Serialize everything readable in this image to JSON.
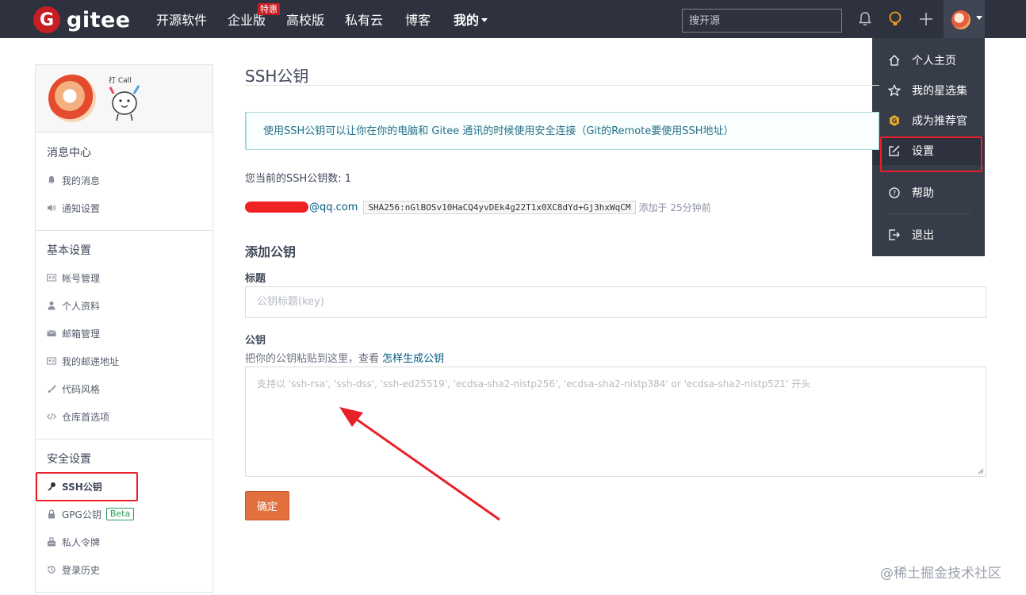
{
  "brand": {
    "logo_letter": "G",
    "name": "gitee"
  },
  "nav": {
    "items": [
      "开源软件",
      "企业版",
      "高校版",
      "私有云",
      "博客"
    ],
    "mine": "我的",
    "special_badge": "特惠",
    "search_placeholder": "搜开源"
  },
  "dropdown": {
    "items": [
      {
        "label": "个人主页",
        "icon": "home-icon"
      },
      {
        "label": "我的星选集",
        "icon": "star-icon"
      },
      {
        "label": "成为推荐官",
        "icon": "gitee-badge-icon"
      },
      {
        "label": "设置",
        "icon": "edit-icon"
      },
      {
        "label": "帮助",
        "icon": "help-icon"
      },
      {
        "label": "退出",
        "icon": "logout-icon"
      }
    ],
    "active": "设置"
  },
  "sidebar": {
    "mascot_text": "打 Call",
    "sections": [
      {
        "title": "消息中心",
        "items": [
          {
            "label": "我的消息",
            "icon": "bell-icon"
          },
          {
            "label": "通知设置",
            "icon": "volume-icon"
          }
        ]
      },
      {
        "title": "基本设置",
        "items": [
          {
            "label": "帐号管理",
            "icon": "id-card-icon"
          },
          {
            "label": "个人资料",
            "icon": "user-icon"
          },
          {
            "label": "邮箱管理",
            "icon": "mail-icon"
          },
          {
            "label": "我的邮递地址",
            "icon": "address-card-icon"
          },
          {
            "label": "代码风格",
            "icon": "brush-icon"
          },
          {
            "label": "仓库首选项",
            "icon": "code-icon"
          }
        ]
      },
      {
        "title": "安全设置",
        "items": [
          {
            "label": "SSH公钥",
            "icon": "key-icon"
          },
          {
            "label": "GPG公钥",
            "icon": "lock-icon",
            "badge": "Beta"
          },
          {
            "label": "私人令牌",
            "icon": "token-icon"
          },
          {
            "label": "登录历史",
            "icon": "history-icon"
          }
        ]
      }
    ],
    "active": "SSH公钥"
  },
  "main": {
    "title": "SSH公钥",
    "info": "使用SSH公钥可以让你在你的电脑和 Gitee 通讯的时候使用安全连接（Git的Remote要使用SSH地址）",
    "count_text": "您当前的SSH公钥数: 1",
    "key": {
      "email_suffix": "@qq.com",
      "fingerprint": "SHA256:nGlBOSv10HaCQ4yvDEk4g22T1x0XC8dYd+Gj3hxWqCM",
      "added": "添加于 25分钟前"
    },
    "add_title": "添加公钥",
    "form": {
      "title_label": "标题",
      "title_placeholder": "公钥标题(key)",
      "key_label": "公钥",
      "key_hint": "把你的公钥粘贴到这里，查看",
      "key_hint_link": "怎样生成公钥",
      "key_placeholder": "支持以 'ssh-rsa', 'ssh-dss', 'ssh-ed25519', 'ecdsa-sha2-nistp256', 'ecdsa-sha2-nistp384' or 'ecdsa-sha2-nistp521' 开头",
      "submit_label": "确定"
    }
  },
  "watermark": "@稀土掘金技术社区",
  "colors": {
    "topbar": "#2d323e",
    "brand_red": "#c71d23",
    "link": "#005980",
    "submit": "#e2703e",
    "annotation_red": "#e8202a"
  }
}
